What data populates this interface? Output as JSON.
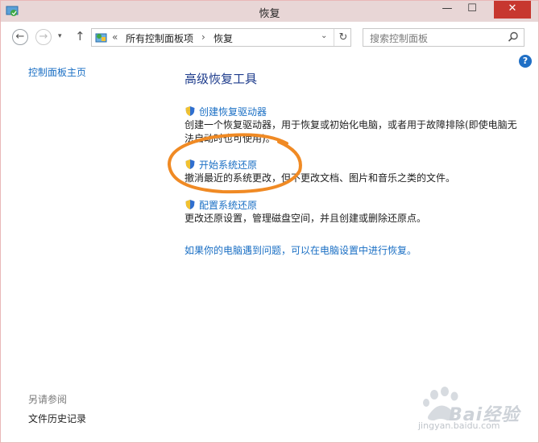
{
  "window": {
    "title": "恢复",
    "min": "—",
    "max": "☐",
    "close": "✕"
  },
  "nav": {
    "back": "←",
    "forward": "→",
    "recent": "▾",
    "up": "↑",
    "address": {
      "crumbs_sep": "«",
      "root": "所有控制面板项",
      "sep": "›",
      "current": "恢复",
      "dropdown": "⌄",
      "refresh": "↻"
    },
    "search": {
      "placeholder": "搜索控制面板"
    }
  },
  "help": "?",
  "sidebar": {
    "home": "控制面板主页",
    "see_also": "另请参阅",
    "file_history": "文件历史记录"
  },
  "main": {
    "title": "高级恢复工具",
    "items": [
      {
        "label": "创建恢复驱动器",
        "desc": "创建一个恢复驱动器，用于恢复或初始化电脑，或者用于故障排除(即使电脑无法启动时也可使用)。"
      },
      {
        "label": "开始系统还原",
        "desc": "撤消最近的系统更改，但不更改文档、图片和音乐之类的文件。"
      },
      {
        "label": "配置系统还原",
        "desc": "更改还原设置，管理磁盘空间，并且创建或删除还原点。"
      }
    ],
    "bottom_link": "如果你的电脑遇到问题，可以在电脑设置中进行恢复。"
  },
  "watermark": {
    "text": "Bai经验",
    "sub": "jingyan.baidu.com"
  },
  "colors": {
    "accent": "#1a6fc4",
    "title_blue": "#1e3c8c",
    "annotation": "#f08a24",
    "close": "#c7372f"
  }
}
